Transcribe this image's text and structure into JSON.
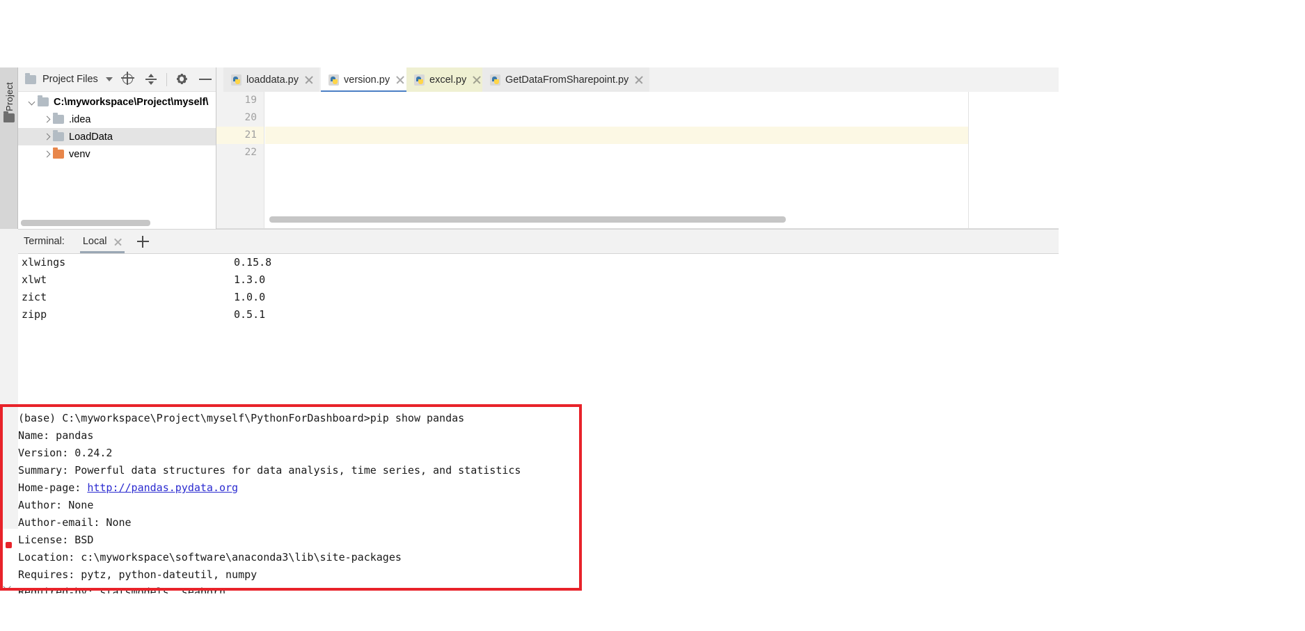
{
  "rail": {
    "project_tab": "1: Project",
    "folder_icon": "folder-icon"
  },
  "project_panel": {
    "header": {
      "title": "Project Files",
      "caret_icon": "chevron-down-icon",
      "locate_icon": "locate-target-icon",
      "collapse_icon": "collapse-all-icon",
      "settings_icon": "gear-icon",
      "hide_icon": "minimize-icon"
    },
    "tree": [
      {
        "label": "C:\\myworkspace\\Project\\myself\\",
        "bold": true,
        "expanded": true,
        "depth": 0,
        "folder": "blue",
        "selected": false
      },
      {
        "label": ".idea",
        "bold": false,
        "expanded": false,
        "depth": 1,
        "folder": "blue",
        "selected": false
      },
      {
        "label": "LoadData",
        "bold": false,
        "expanded": false,
        "depth": 1,
        "folder": "blue",
        "selected": true
      },
      {
        "label": "venv",
        "bold": false,
        "expanded": false,
        "depth": 1,
        "folder": "orange",
        "selected": false
      }
    ]
  },
  "editor": {
    "tabs": [
      {
        "label": "loaddata.py",
        "state": "normal",
        "icon": "python-file-icon",
        "close_icon": "close-icon"
      },
      {
        "label": "version.py",
        "state": "active",
        "icon": "python-file-icon",
        "close_icon": "close-icon"
      },
      {
        "label": "excel.py",
        "state": "highlight",
        "icon": "python-file-icon",
        "close_icon": "close-icon"
      },
      {
        "label": "GetDataFromSharepoint.py",
        "state": "normal",
        "icon": "python-file-icon",
        "close_icon": "close-icon"
      }
    ],
    "line_numbers": [
      "19",
      "20",
      "21",
      "22"
    ],
    "highlighted_line": "21",
    "code_lines": [
      "",
      "",
      "",
      ""
    ]
  },
  "terminal": {
    "title": "Terminal:",
    "tab": "Local",
    "close_icon": "close-icon",
    "add_icon": "plus-icon",
    "packages": [
      {
        "name": "xlwings",
        "version": "0.15.8"
      },
      {
        "name": "xlwt",
        "version": "1.3.0"
      },
      {
        "name": "zict",
        "version": "1.0.0"
      },
      {
        "name": "zipp",
        "version": "0.5.1"
      }
    ],
    "pip_show": {
      "prompt": "(base) C:\\myworkspace\\Project\\myself\\PythonForDashboard>pip show pandas",
      "name": "Name: pandas",
      "version": "Version: 0.24.2",
      "summary": "Summary: Powerful data structures for data analysis, time series, and statistics",
      "home_page_label": "Home-page: ",
      "home_page_url": "http://pandas.pydata.org",
      "author": "Author: None",
      "author_email": "Author-email: None",
      "license": "License: BSD",
      "location": "Location: c:\\myworkspace\\software\\anaconda3\\lib\\site-packages",
      "requires": "Requires: pytz, python-dateutil, numpy",
      "required_by": "Required-by: statsmodels, seaborn"
    }
  },
  "colors": {
    "accent_tab_underline": "#4b7fc4",
    "terminal_tab_underline": "#9aa7b4",
    "annotation_red": "#e8232a",
    "highlight_line": "#fcf8e4",
    "excel_tab_bg": "#eff0d2",
    "link_blue": "#2b2bd0",
    "venv_folder": "#e8864a"
  }
}
